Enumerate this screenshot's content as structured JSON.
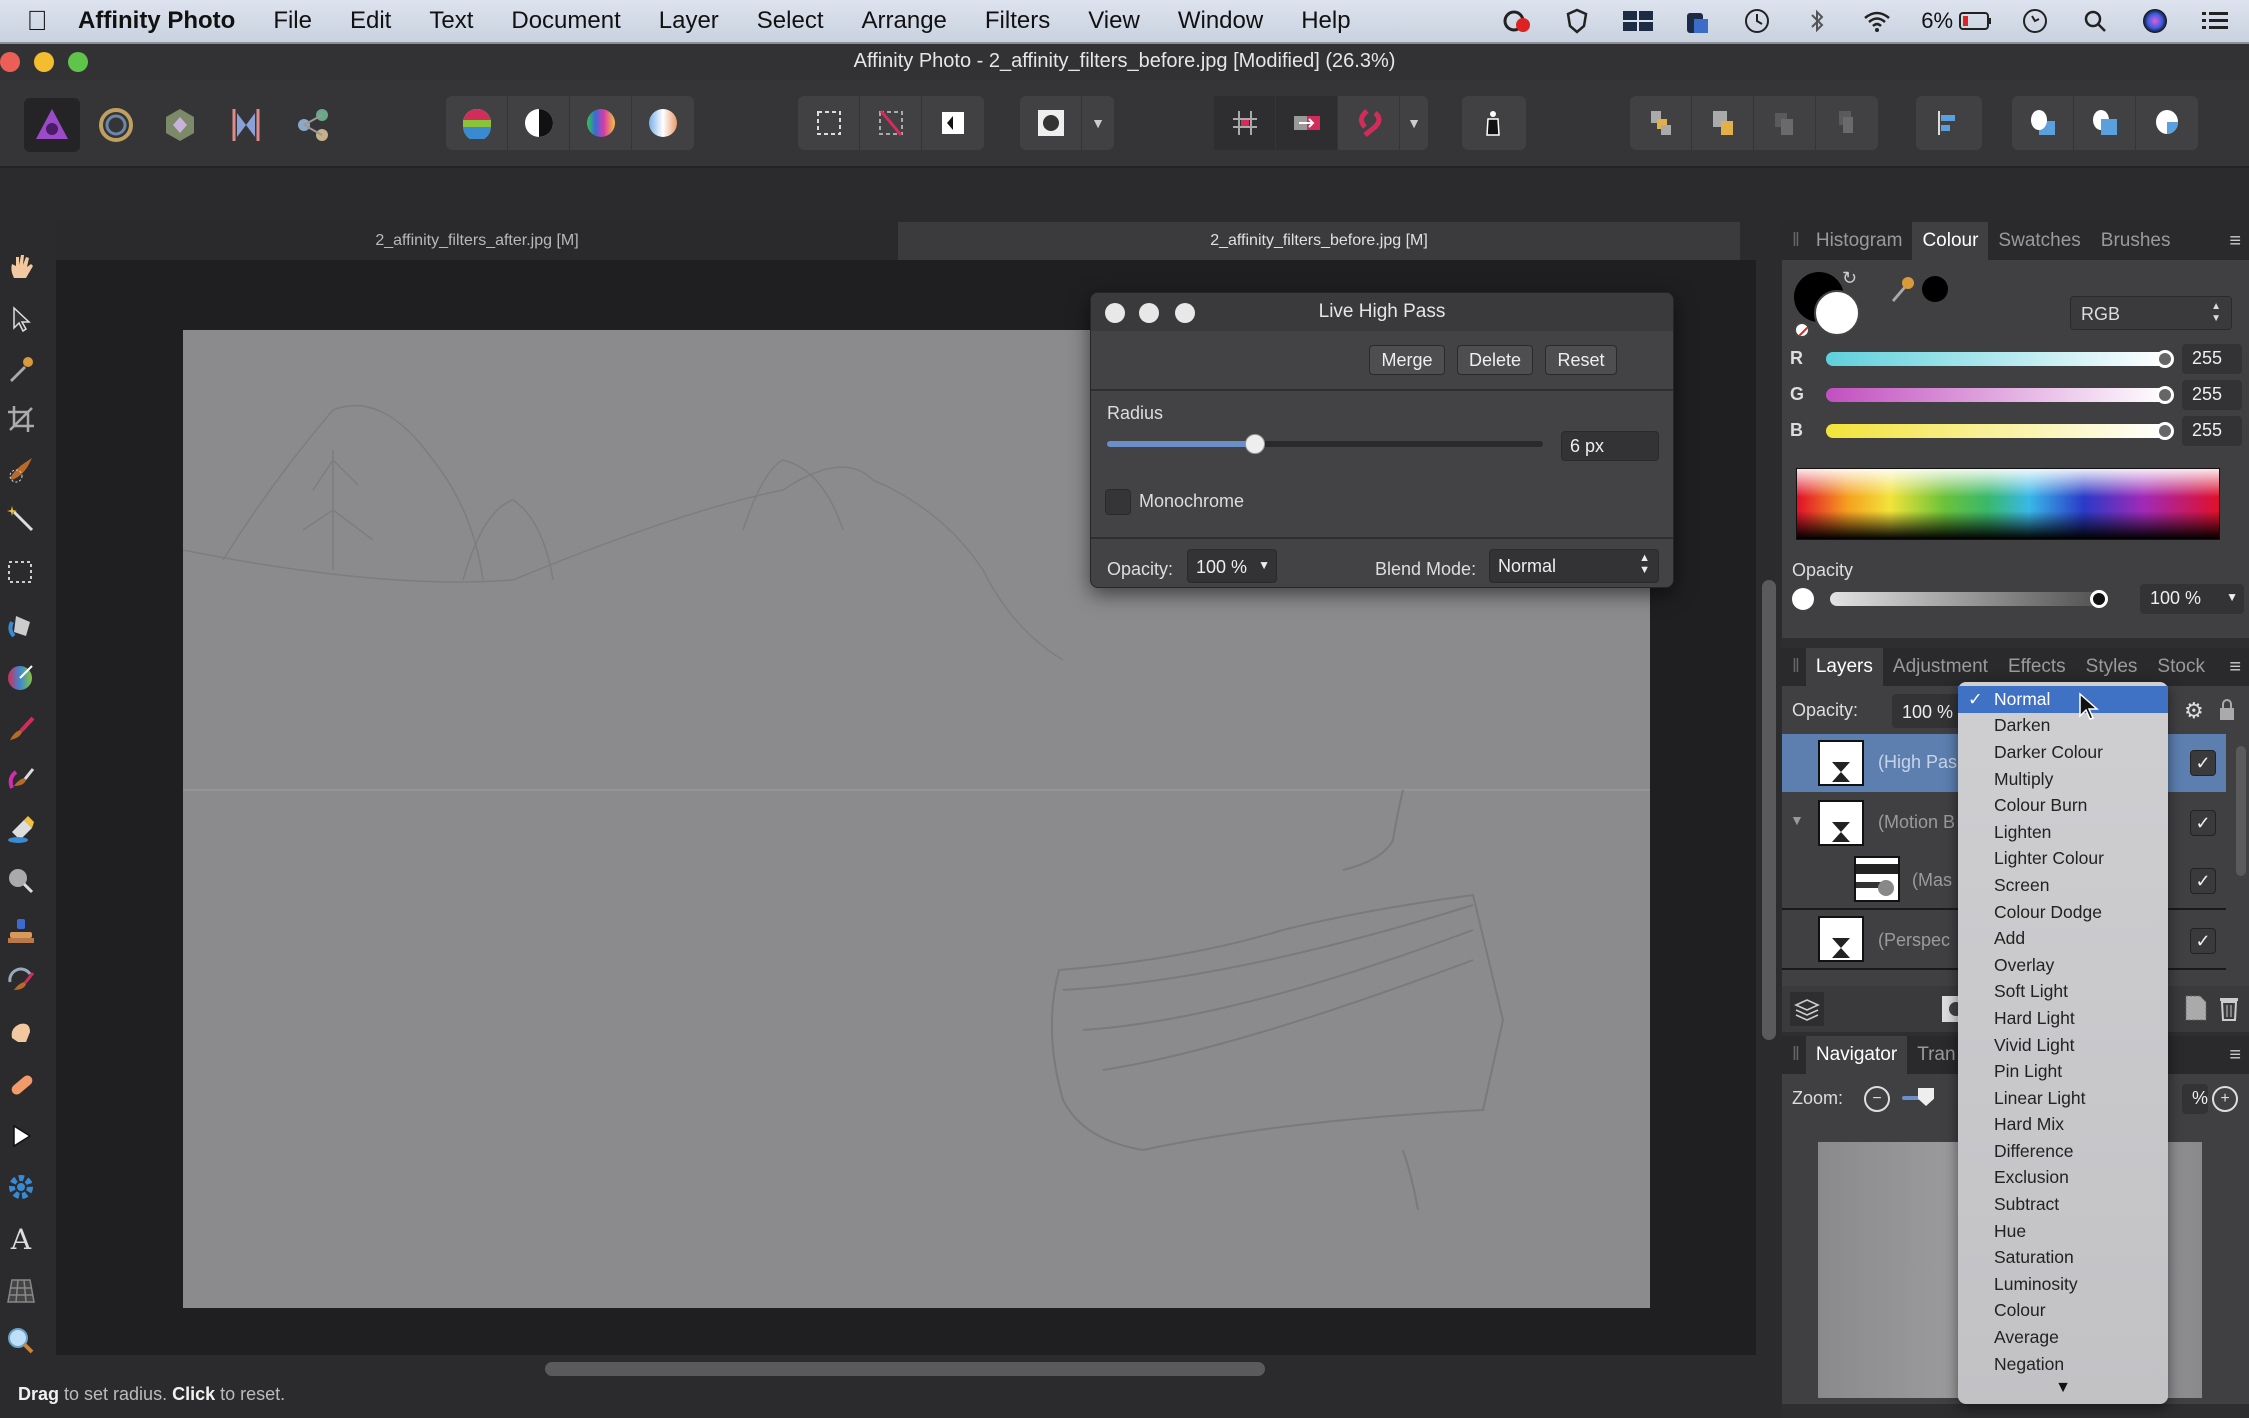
{
  "menubar": {
    "app_name": "Affinity Photo",
    "items": [
      "File",
      "Edit",
      "Text",
      "Document",
      "Layer",
      "Select",
      "Arrange",
      "Filters",
      "View",
      "Window",
      "Help"
    ],
    "status": {
      "battery": "6%"
    },
    "status_icons": [
      "creative-cloud-icon",
      "shield-icon",
      "spaces-icon",
      "camera-icon",
      "time-machine-icon",
      "bluetooth-icon",
      "wifi-icon",
      "battery-icon",
      "clock-icon",
      "spotlight-search-icon",
      "siri-icon",
      "notification-center-icon"
    ]
  },
  "window": {
    "title": "Affinity Photo - 2_affinity_filters_before.jpg [Modified] (26.3%)"
  },
  "toolbar": {
    "personas": [
      "photo-persona-icon",
      "liquify-persona-icon",
      "develop-persona-icon",
      "tone-mapping-persona-icon",
      "export-persona-icon"
    ],
    "adjust_group": [
      "auto-levels-icon",
      "auto-contrast-icon",
      "auto-colour-icon",
      "auto-white-balance-icon"
    ],
    "selection_group": [
      "marquee-selection-icon",
      "deselect-icon",
      "invert-selection-icon"
    ],
    "mask_group": [
      "quick-mask-icon"
    ],
    "snap_group": [
      "grid-icon",
      "snap-to-icon",
      "snapping-magnet-icon"
    ],
    "assistant_group": [
      "assistant-icon"
    ],
    "arrange_group": [
      "move-back-icon",
      "move-forward-icon",
      "move-to-back-icon",
      "move-to-front-icon"
    ],
    "align_group": [
      "align-left-icon"
    ],
    "boolean_group": [
      "add-shapes-icon",
      "subtract-shapes-icon",
      "intersect-shapes-icon"
    ]
  },
  "doc_tabs": [
    {
      "label": "2_affinity_filters_after.jpg [M]",
      "active": false
    },
    {
      "label": "2_affinity_filters_before.jpg [M]",
      "active": true
    }
  ],
  "tools": [
    "hand-tool-icon",
    "move-tool-icon",
    "colour-picker-tool-icon",
    "crop-tool-icon",
    "selection-brush-tool-icon",
    "flood-select-tool-icon",
    "rectangular-marquee-tool-icon",
    "flood-fill-tool-icon",
    "gradient-tool-icon",
    "paint-brush-tool-icon",
    "colour-replacement-tool-icon",
    "erase-brush-tool-icon",
    "dodge-tool-icon",
    "clone-tool-icon",
    "undo-brush-tool-icon",
    "smudge-tool-icon",
    "healing-brush-tool-icon",
    "node-tool-icon",
    "shape-tool-icon",
    "artistic-text-tool-icon",
    "mesh-warp-tool-icon",
    "zoom-tool-icon"
  ],
  "dialog": {
    "title": "Live High Pass",
    "buttons": {
      "merge": "Merge",
      "delete": "Delete",
      "reset": "Reset"
    },
    "radius_label": "Radius",
    "radius_value": "6 px",
    "radius_fraction": 0.34,
    "monochrome_label": "Monochrome",
    "monochrome_checked": false,
    "opacity_label": "Opacity:",
    "opacity_value": "100 %",
    "blend_label": "Blend Mode:",
    "blend_value": "Normal"
  },
  "colour_panel": {
    "tabs": [
      "Histogram",
      "Colour",
      "Swatches",
      "Brushes"
    ],
    "active_tab": "Colour",
    "model": "RGB",
    "channels": [
      {
        "label": "R",
        "value": "255",
        "color": "#5fd0dc"
      },
      {
        "label": "G",
        "value": "255",
        "color": "#c24fc0"
      },
      {
        "label": "B",
        "value": "255",
        "color": "#f2e33a"
      }
    ],
    "opacity_label": "Opacity",
    "opacity_value": "100 %"
  },
  "layers_panel": {
    "tabs": [
      "Layers",
      "Adjustment",
      "Effects",
      "Styles",
      "Stock"
    ],
    "active_tab": "Layers",
    "opacity_label": "Opacity:",
    "opacity_value": "100 %",
    "layers": [
      {
        "name": "(High Pas",
        "selected": true,
        "visible": true
      },
      {
        "name": "(Motion B",
        "selected": false,
        "visible": true
      },
      {
        "name": "(Mas",
        "selected": false,
        "visible": true
      },
      {
        "name": "(Perspec",
        "selected": false,
        "visible": true
      }
    ]
  },
  "navigator_panel": {
    "tabs": [
      "Navigator",
      "Tran"
    ],
    "active_tab": "Navigator",
    "zoom_label": "Zoom:",
    "zoom_value_partial": "%"
  },
  "blend_menu": {
    "selected": "Normal",
    "items": [
      "Normal",
      "Darken",
      "Darker Colour",
      "Multiply",
      "Colour Burn",
      "Lighten",
      "Lighter Colour",
      "Screen",
      "Colour Dodge",
      "Add",
      "Overlay",
      "Soft Light",
      "Hard Light",
      "Vivid Light",
      "Pin Light",
      "Linear Light",
      "Hard Mix",
      "Difference",
      "Exclusion",
      "Subtract",
      "Hue",
      "Saturation",
      "Luminosity",
      "Colour",
      "Average",
      "Negation"
    ]
  },
  "statusbar": {
    "drag": "Drag",
    "drag_rest": " to set radius. ",
    "click": "Click",
    "click_rest": " to reset."
  },
  "colors": {
    "accent": "#3f72c4",
    "selected_layer": "#5c7fb0"
  }
}
